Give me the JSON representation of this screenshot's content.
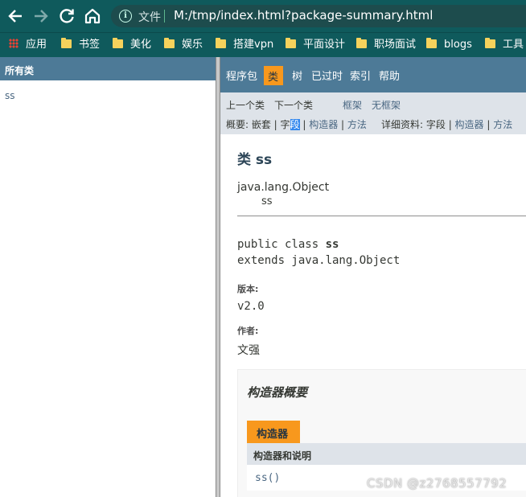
{
  "browser": {
    "address_protocol": "文件",
    "address_url": "M:/tmp/index.html?package-summary.html",
    "bookmarks": [
      "应用",
      "书签",
      "美化",
      "娱乐",
      "搭建vpn",
      "平面设计",
      "职场面试",
      "blogs",
      "工具"
    ]
  },
  "left_frame": {
    "header": "所有类",
    "classes": [
      "ss"
    ]
  },
  "right_frame": {
    "nav": [
      "程序包",
      "类",
      "树",
      "已过时",
      "索引",
      "帮助"
    ],
    "subnav": {
      "prev_class": "上一个类",
      "next_class": "下一个类",
      "frames": "框架",
      "no_frames": "无框架",
      "summary_prefix": "概要: 嵌套 | 字",
      "summary_highlight": "段",
      "summary_sep1": " | ",
      "summary_constructor": "构造器",
      "summary_sep2": " | ",
      "summary_method": "方法",
      "detail_prefix": "详细资料: ",
      "detail_field": "字段",
      "detail_sep1": " | ",
      "detail_constructor": "构造器",
      "detail_sep2": " | ",
      "detail_method": "方法"
    },
    "class_title": "类 ss",
    "inheritance_root": "java.lang.Object",
    "inheritance_child": "ss",
    "signature_prefix": "public class ",
    "signature_name": "ss",
    "signature_extends": "extends java.lang.Object",
    "version_label": "版本:",
    "version_value": "v2.0",
    "author_label": "作者:",
    "author_value": "文强",
    "constructor_summary": {
      "title": "构造器概要",
      "caption": "构造器",
      "column_header": "构造器和说明",
      "rows": [
        "ss()"
      ]
    }
  },
  "watermark": "CSDN @z2768557792",
  "colors": {
    "chrome_teal": "#0f5a5c",
    "nav_blue": "#4d7a97",
    "active_orange": "#f8981d",
    "subnav_gray": "#dee3e9",
    "link": "#4a6782"
  }
}
